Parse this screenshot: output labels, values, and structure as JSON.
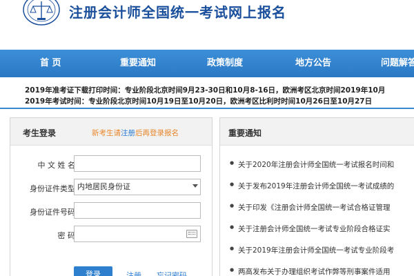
{
  "header": {
    "title": "注册会计师全国统一考试网上报名"
  },
  "nav": {
    "items": [
      "首  页",
      "重要通知",
      "政策制度",
      "地方公告",
      "问题解答"
    ]
  },
  "notices": {
    "line1": "2019年准考证下载打印时间：专业阶段北京时间9月23-30日和10月8-16日，欧洲考区北京时间2019年10月",
    "line2": "2019年考试时间：专业阶段北京时间10月19日至10月20日，欧洲考区比利时时间10月26日至10月27日"
  },
  "login": {
    "title": "考生登录",
    "hint_prefix": "新考生请",
    "hint_link": "注册",
    "hint_suffix": "后再登录报名",
    "fields": {
      "name_label": "中 文  姓 名",
      "id_type_label": "身份证件类型",
      "id_type_value": "内地居民身份证",
      "id_number_label": "身份证件号码",
      "password_label": "密         码"
    },
    "login_button": "登录",
    "register_link": "注册",
    "forgot_link": "忘记密码"
  },
  "news": {
    "title": "重要通知",
    "items": [
      "关于2020年注册会计师全国统一考试报名时间和",
      "关于发布2019年注册会计师全国统一考试成绩的",
      "关于印发《注册会计师全国统一考试合格证管理",
      "关于注册会计师全国统一考试专业阶段合格证实",
      "关于2019年注册会计师全国统一考试专业阶段考",
      "两高发布关于办理组织考试作弊等刑事案件适用"
    ]
  }
}
